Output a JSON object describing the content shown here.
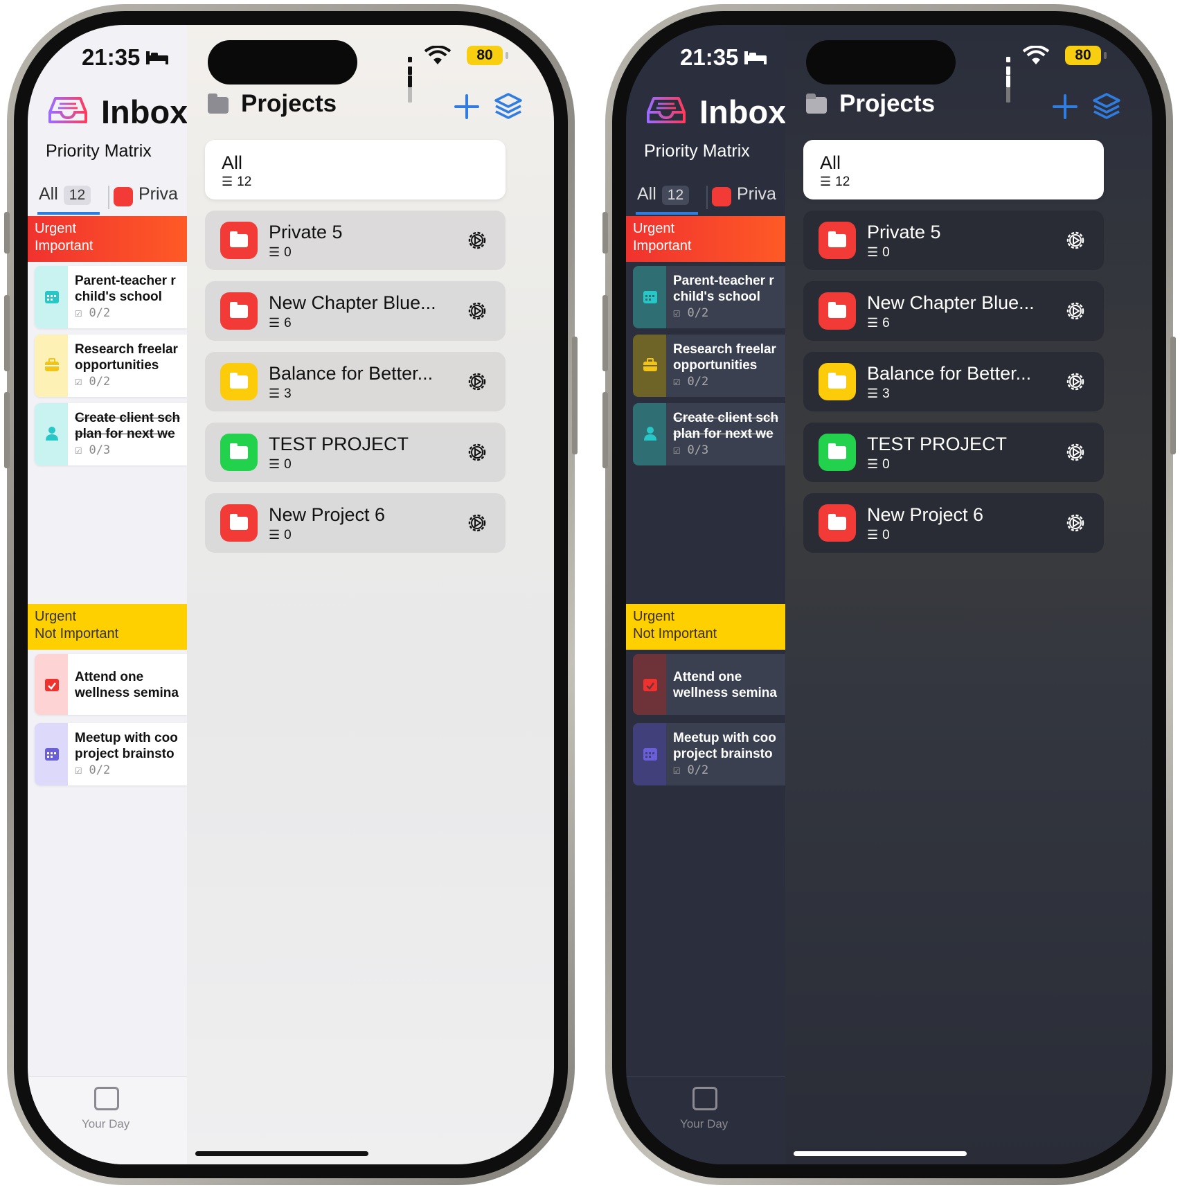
{
  "status_bar": {
    "time": "21:35",
    "battery": "80"
  },
  "inbox": {
    "title": "Inbox",
    "subtitle": "Priority Matrix",
    "tabs": {
      "all_label": "All",
      "all_count": "12",
      "private_label": "Priva"
    },
    "quadrants": [
      {
        "line1": "Urgent",
        "line2": "Important",
        "color": "#f0322f"
      },
      {
        "line1": "Urgent",
        "line2": "Not Important",
        "color": "#ffd000"
      }
    ],
    "tasks": [
      {
        "line1": "Parent-teacher r",
        "line2": "child's school",
        "progress": "0/2",
        "icon": "calendar-icon",
        "color": "#27c7c7"
      },
      {
        "line1": "Research freelar",
        "line2": "opportunities",
        "progress": "0/2",
        "icon": "briefcase-icon",
        "color": "#f2c418"
      },
      {
        "line1": "Create client sch",
        "line2": "plan for next we",
        "progress": "0/3",
        "icon": "person-icon",
        "color": "#27c7c7"
      },
      {
        "line1": "Attend one",
        "line2": "wellness semina",
        "progress": "",
        "icon": "calendar-check-icon",
        "color": "#f0322f"
      },
      {
        "line1": "Meetup with coo",
        "line2": "project brainsto",
        "progress": "0/2",
        "icon": "calendar-icon",
        "color": "#6a5fd8"
      }
    ],
    "your_day_label": "Your Day"
  },
  "projects": {
    "title": "Projects",
    "all": {
      "name": "All",
      "count": "12"
    },
    "items": [
      {
        "name": "Private 5",
        "count": "0",
        "color": "#f23b36"
      },
      {
        "name": "New Chapter Blue...",
        "count": "6",
        "color": "#f23b36"
      },
      {
        "name": "Balance for Better...",
        "count": "3",
        "color": "#fccb0a"
      },
      {
        "name": "TEST PROJECT",
        "count": "0",
        "color": "#22d14c"
      },
      {
        "name": "New Project 6",
        "count": "0",
        "color": "#f23b36"
      }
    ]
  },
  "accent": "#2f7de1"
}
